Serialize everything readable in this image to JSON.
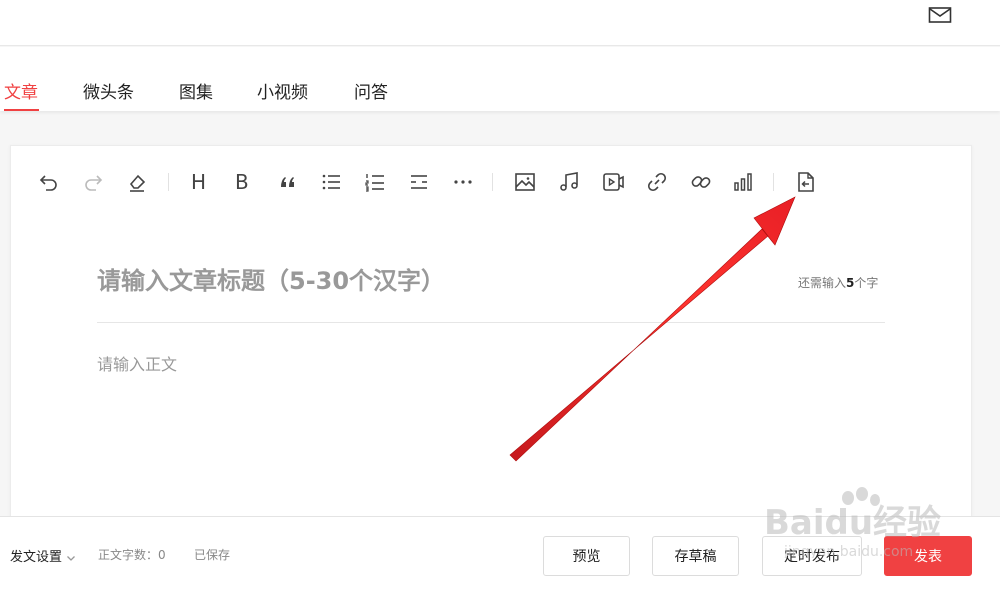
{
  "tabs": [
    {
      "label": "文章",
      "active": true
    },
    {
      "label": "微头条"
    },
    {
      "label": "图集"
    },
    {
      "label": "小视频"
    },
    {
      "label": "问答"
    }
  ],
  "toolbar": {
    "icons": [
      "undo-icon",
      "redo-icon",
      "clear-format-icon",
      "heading-icon",
      "bold-icon",
      "quote-icon",
      "bullet-list-icon",
      "numbered-list-icon",
      "divider-icon",
      "more-icon",
      "image-icon",
      "music-icon",
      "video-icon",
      "link-icon",
      "attachment-link-icon",
      "chart-icon",
      "import-document-icon"
    ],
    "heading_label": "H",
    "bold_label": "B"
  },
  "editor": {
    "title_placeholder": "请输入文章标题（5-30个汉字）",
    "counter_prefix": "还需输入",
    "counter_value": "5",
    "counter_suffix": "个字",
    "body_placeholder": "请输入正文"
  },
  "footer": {
    "settings_label": "发文设置",
    "word_count_label": "正文字数：0",
    "saved_label": "已保存",
    "preview_label": "预览",
    "save_draft_label": "存草稿",
    "schedule_label": "定时发布",
    "publish_label": "发表"
  },
  "watermark": {
    "text": "Baidu经验",
    "url": "jingyan.baidu.com"
  },
  "colors": {
    "accent": "#f04142",
    "annotation_arrow": "#e8141b"
  }
}
